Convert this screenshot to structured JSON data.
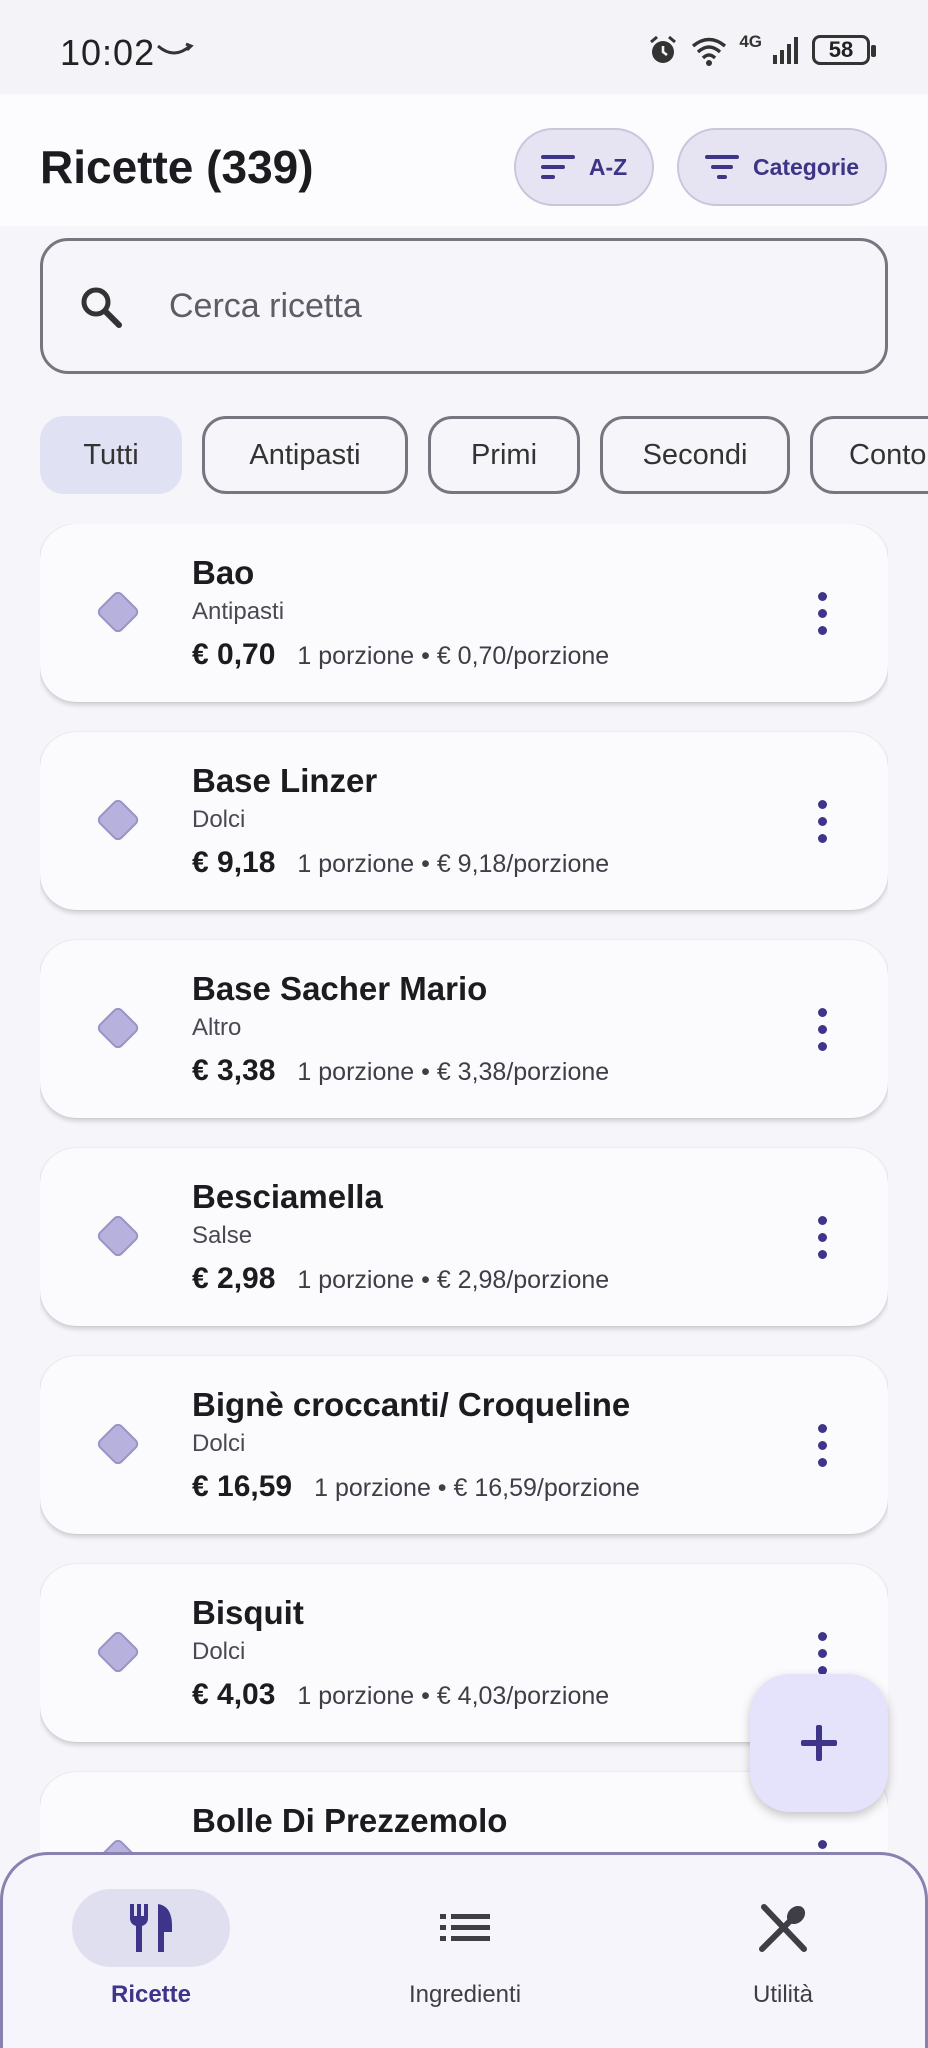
{
  "status_bar": {
    "time": "10:02",
    "network": "4G",
    "battery": "58"
  },
  "header": {
    "title": "Ricette (339)",
    "sort_label": "A-Z",
    "categories_label": "Categorie"
  },
  "search": {
    "placeholder": "Cerca ricetta",
    "value": ""
  },
  "chips": [
    "Tutti",
    "Antipasti",
    "Primi",
    "Secondi",
    "Contorni"
  ],
  "chips_selected": "Tutti",
  "recipes": [
    {
      "name": "Bao",
      "category": "Antipasti",
      "price": "€ 0,70",
      "portion": "1 porzione • € 0,70/porzione"
    },
    {
      "name": "Base Linzer",
      "category": "Dolci",
      "price": "€ 9,18",
      "portion": "1 porzione • € 9,18/porzione"
    },
    {
      "name": "Base Sacher Mario",
      "category": "Altro",
      "price": "€ 3,38",
      "portion": "1 porzione • € 3,38/porzione"
    },
    {
      "name": "Besciamella",
      "category": "Salse",
      "price": "€ 2,98",
      "portion": "1 porzione • € 2,98/porzione"
    },
    {
      "name": "Bignè croccanti/ Croqueline",
      "category": "Dolci",
      "price": "€ 16,59",
      "portion": "1 porzione • € 16,59/porzione"
    },
    {
      "name": "Bisquit",
      "category": "Dolci",
      "price": "€ 4,03",
      "portion": "1 porzione • € 4,03/porzione"
    },
    {
      "name": "Bolle Di Prezzemolo",
      "category": "",
      "price": "",
      "portion": ""
    }
  ],
  "bottom_nav": {
    "recipes": "Ricette",
    "ingredients": "Ingredienti",
    "utilities": "Utilità"
  },
  "colors": {
    "accent": "#3e3489",
    "chip_selected": "#e0e2f3",
    "fab": "#e5e3fb"
  },
  "icons": {
    "sort": "sort-icon",
    "filter": "filter-icon",
    "search": "search-icon",
    "more": "more-vert-icon",
    "add": "add-icon",
    "recipes": "fork-knife-icon",
    "ingredients": "list-icon",
    "utilities": "utensils-cross-icon"
  }
}
